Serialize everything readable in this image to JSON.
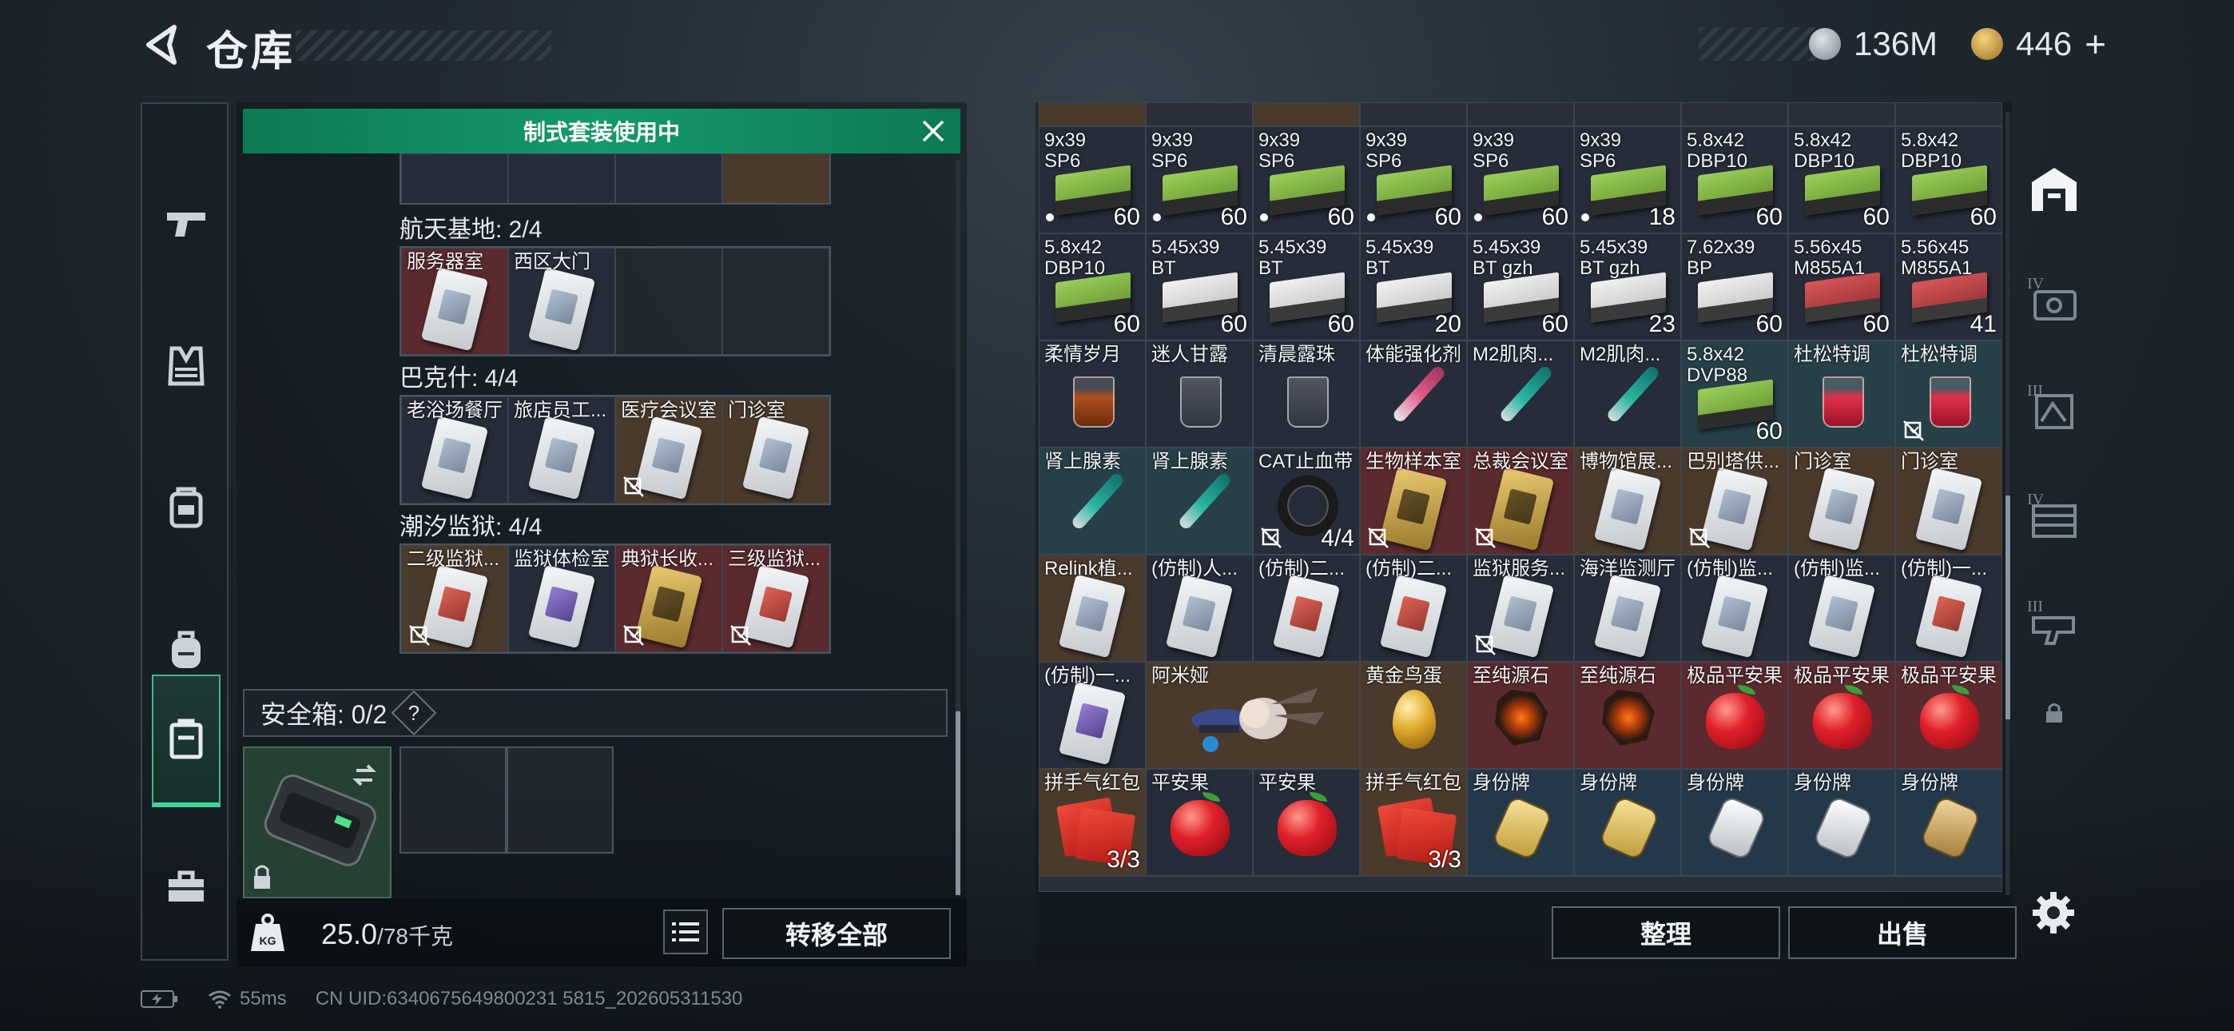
{
  "header": {
    "title": "仓库",
    "silver_amount": "136M",
    "gold_amount": "446",
    "add_symbol": "+"
  },
  "nav": {
    "items": [
      "weapon",
      "armor",
      "chest-rig",
      "backpack",
      "container",
      "toolbox"
    ],
    "active_index": 4
  },
  "left": {
    "banner": "制式套装使用中",
    "groups": [
      {
        "label": "航天基地: 2/4",
        "cells": [
          {
            "label": "服务器室",
            "bg": "red",
            "card": "plain"
          },
          {
            "label": "西区大门",
            "bg": "dark",
            "card": "plain"
          },
          {
            "label": "",
            "bg": "empty"
          },
          {
            "label": "",
            "bg": "empty"
          }
        ]
      },
      {
        "label": "巴克什: 4/4",
        "cells": [
          {
            "label": "老浴场餐厅",
            "bg": "dark",
            "card": "plain"
          },
          {
            "label": "旅店员工...",
            "bg": "dark",
            "card": "plain"
          },
          {
            "label": "医疗会议室",
            "bg": "brown",
            "card": "plain",
            "nodrop": true
          },
          {
            "label": "门诊室",
            "bg": "brown",
            "card": "plain"
          }
        ]
      },
      {
        "label": "潮汐监狱: 4/4",
        "cells": [
          {
            "label": "二级监狱...",
            "bg": "brown",
            "card": "red",
            "nodrop": true
          },
          {
            "label": "监狱体检室",
            "bg": "dark",
            "card": "purple"
          },
          {
            "label": "典狱长收...",
            "bg": "red",
            "card": "gold",
            "nodrop": true
          },
          {
            "label": "三级监狱...",
            "bg": "red",
            "card": "red",
            "nodrop": true
          }
        ]
      }
    ],
    "safe_box": {
      "label": "安全箱: 0/2",
      "help": "?"
    },
    "weight": {
      "current": "25.0",
      "max": "/78千克"
    },
    "transfer_all": "转移全部"
  },
  "right": {
    "top_partial": [
      "",
      "",
      "",
      "",
      "",
      "",
      "",
      "",
      ""
    ],
    "rows": [
      [
        {
          "label": "9x39\nSP6",
          "kind": "ammo-green",
          "qty": "60",
          "dot": true,
          "bg": "dark"
        },
        {
          "label": "9x39\nSP6",
          "kind": "ammo-green",
          "qty": "60",
          "dot": true,
          "bg": "dark"
        },
        {
          "label": "9x39\nSP6",
          "kind": "ammo-green",
          "qty": "60",
          "dot": true,
          "bg": "dark"
        },
        {
          "label": "9x39\nSP6",
          "kind": "ammo-green",
          "qty": "60",
          "dot": true,
          "bg": "dark"
        },
        {
          "label": "9x39\nSP6",
          "kind": "ammo-green",
          "qty": "60",
          "dot": true,
          "bg": "dark"
        },
        {
          "label": "9x39\nSP6",
          "kind": "ammo-green",
          "qty": "18",
          "dot": true,
          "bg": "dark"
        },
        {
          "label": "5.8x42\nDBP10",
          "kind": "ammo-green",
          "qty": "60",
          "bg": "dark"
        },
        {
          "label": "5.8x42\nDBP10",
          "kind": "ammo-green",
          "qty": "60",
          "bg": "dark"
        },
        {
          "label": "5.8x42\nDBP10",
          "kind": "ammo-green",
          "qty": "60",
          "bg": "dark"
        }
      ],
      [
        {
          "label": "5.8x42\nDBP10",
          "kind": "ammo-green",
          "qty": "60",
          "bg": "dark"
        },
        {
          "label": "5.45x39\nBT",
          "kind": "ammo-white",
          "qty": "60",
          "bg": "dark"
        },
        {
          "label": "5.45x39\nBT",
          "kind": "ammo-white",
          "qty": "60",
          "bg": "dark"
        },
        {
          "label": "5.45x39\nBT",
          "kind": "ammo-white",
          "qty": "20",
          "bg": "dark"
        },
        {
          "label": "5.45x39\nBT gzh",
          "kind": "ammo-white",
          "qty": "60",
          "bg": "dark"
        },
        {
          "label": "5.45x39\nBT gzh",
          "kind": "ammo-white",
          "qty": "23",
          "bg": "dark"
        },
        {
          "label": "7.62x39\nBP",
          "kind": "ammo-white",
          "qty": "60",
          "bg": "dark"
        },
        {
          "label": "5.56x45\nM855A1",
          "kind": "ammo-red",
          "qty": "60",
          "bg": "dark"
        },
        {
          "label": "5.56x45\nM855A1",
          "kind": "ammo-red",
          "qty": "41",
          "bg": "dark"
        }
      ],
      [
        {
          "label": "柔情岁月",
          "kind": "glass-amber",
          "bg": "dark"
        },
        {
          "label": "迷人甘露",
          "kind": "glass",
          "bg": "dark"
        },
        {
          "label": "清晨露珠",
          "kind": "glass",
          "bg": "dark"
        },
        {
          "label": "体能强化剂",
          "kind": "syringe-pink",
          "bg": "dark"
        },
        {
          "label": "M2肌肉...",
          "kind": "syringe",
          "bg": "dark"
        },
        {
          "label": "M2肌肉...",
          "kind": "syringe",
          "bg": "dark"
        },
        {
          "label": "5.8x42\nDVP88",
          "kind": "ammo-green",
          "qty": "60",
          "bg": "teal"
        },
        {
          "label": "杜松特调",
          "kind": "glass-red",
          "bg": "teal"
        },
        {
          "label": "杜松特调",
          "kind": "glass-red",
          "nodrop": true,
          "bg": "teal"
        }
      ],
      [
        {
          "label": "肾上腺素",
          "kind": "syringe",
          "bg": "teal"
        },
        {
          "label": "肾上腺素",
          "kind": "syringe",
          "bg": "teal"
        },
        {
          "label": "CAT止血带",
          "kind": "band",
          "qty": "4/4",
          "nodrop": true,
          "bg": "dark"
        },
        {
          "label": "生物样本室",
          "kind": "card-gold",
          "nodrop": true,
          "bg": "red"
        },
        {
          "label": "总裁会议室",
          "kind": "card-gold",
          "nodrop": true,
          "bg": "red"
        },
        {
          "label": "博物馆展...",
          "kind": "card",
          "bg": "brown"
        },
        {
          "label": "巴别塔供...",
          "kind": "card",
          "nodrop": true,
          "bg": "brown"
        },
        {
          "label": "门诊室",
          "kind": "card",
          "bg": "brown"
        },
        {
          "label": "门诊室",
          "kind": "card",
          "bg": "brown"
        }
      ],
      [
        {
          "label": "Relink植...",
          "kind": "card",
          "bg": "brown"
        },
        {
          "label": "(仿制)人...",
          "kind": "card",
          "bg": "dark"
        },
        {
          "label": "(仿制)二...",
          "kind": "card-red",
          "bg": "dark"
        },
        {
          "label": "(仿制)二...",
          "kind": "card-red",
          "bg": "dark"
        },
        {
          "label": "监狱服务...",
          "kind": "card",
          "nodrop": true,
          "bg": "dark"
        },
        {
          "label": "海洋监测厅",
          "kind": "card",
          "bg": "dark"
        },
        {
          "label": "(仿制)监...",
          "kind": "card",
          "bg": "dark"
        },
        {
          "label": "(仿制)监...",
          "kind": "card",
          "bg": "dark"
        },
        {
          "label": "(仿制)一...",
          "kind": "card-red",
          "bg": "dark"
        }
      ],
      [
        {
          "label": "(仿制)一...",
          "kind": "card-purple",
          "bg": "dark"
        },
        {
          "label": "阿米娅",
          "kind": "doll",
          "bg": "brown",
          "span": 2
        },
        {
          "label": "黄金鸟蛋",
          "kind": "egg",
          "bg": "brown"
        },
        {
          "label": "至纯源石",
          "kind": "stone",
          "bg": "red"
        },
        {
          "label": "至纯源石",
          "kind": "stone",
          "bg": "red"
        },
        {
          "label": "极品平安果",
          "kind": "apple",
          "bg": "red"
        },
        {
          "label": "极品平安果",
          "kind": "apple",
          "bg": "red"
        },
        {
          "label": "极品平安果",
          "kind": "apple",
          "bg": "red"
        }
      ],
      [
        {
          "label": "拼手气红包",
          "kind": "envelope",
          "qty": "3/3",
          "bg": "brown"
        },
        {
          "label": "平安果",
          "kind": "apple",
          "bg": "dark"
        },
        {
          "label": "平安果",
          "kind": "apple",
          "bg": "dark"
        },
        {
          "label": "拼手气红包",
          "kind": "envelope",
          "qty": "3/3",
          "bg": "brown"
        },
        {
          "label": "身份牌",
          "kind": "tag-gold",
          "bg": "blue"
        },
        {
          "label": "身份牌",
          "kind": "tag-gold",
          "bg": "blue"
        },
        {
          "label": "身份牌",
          "kind": "tag-silver",
          "bg": "blue"
        },
        {
          "label": "身份牌",
          "kind": "tag-silver",
          "bg": "blue"
        },
        {
          "label": "身份牌",
          "kind": "tag-bronze",
          "bg": "blue"
        }
      ]
    ],
    "sort_button": "整理",
    "sell_button": "出售"
  },
  "side_tabs": [
    "warehouse",
    "IV",
    "III",
    "IV",
    "III",
    "locked"
  ],
  "status": {
    "ping": "55ms",
    "uid": "CN UID:6340675649800231 5815_202605311530"
  }
}
